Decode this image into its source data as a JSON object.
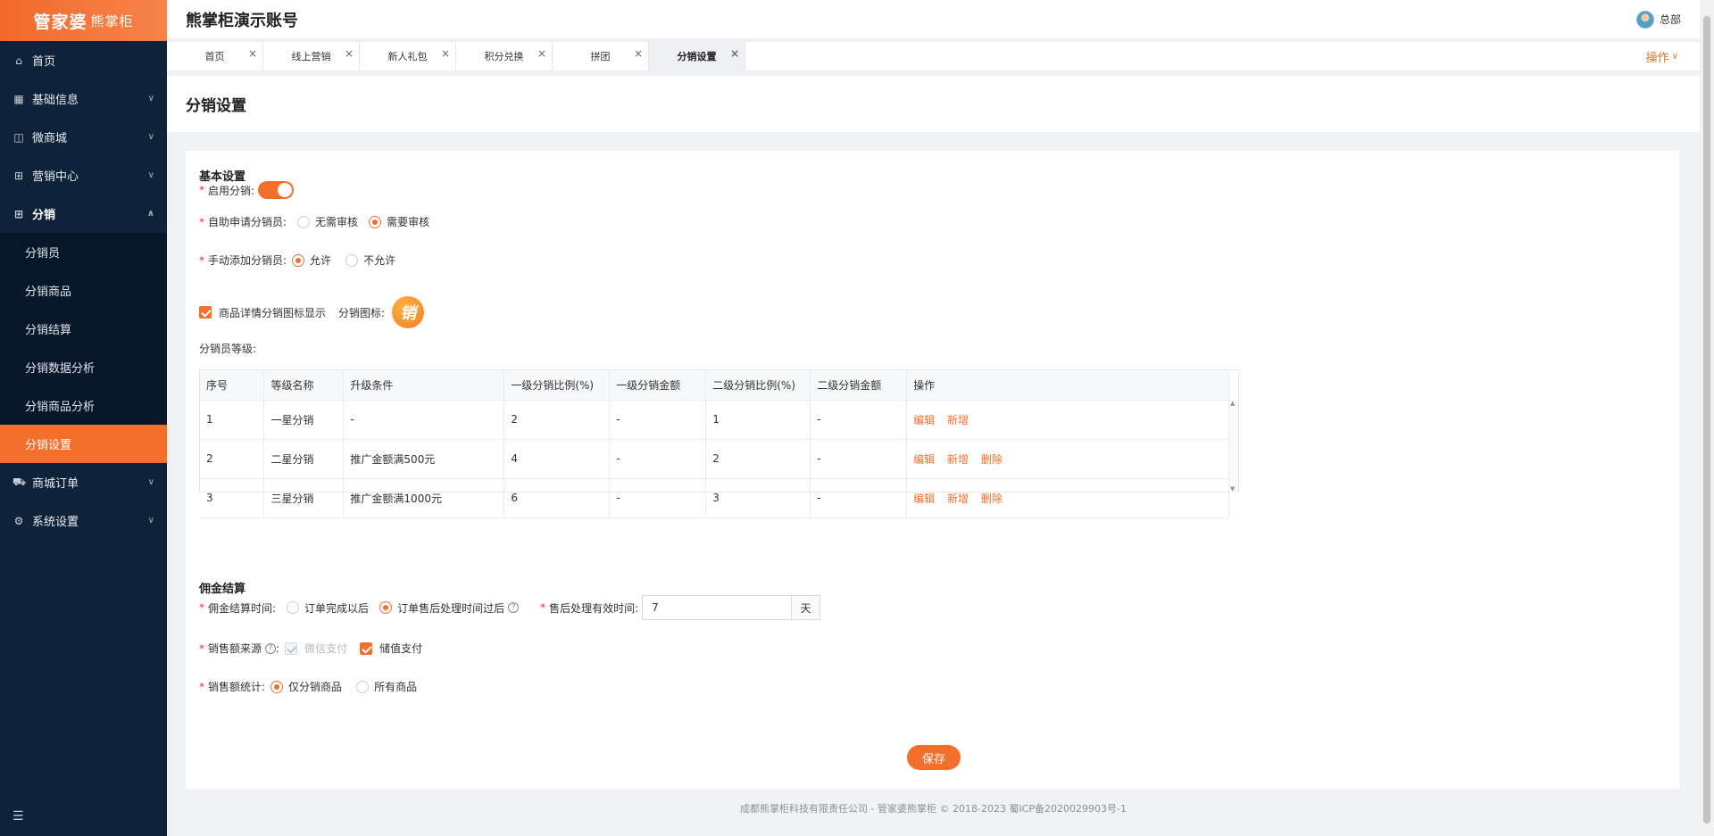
{
  "brand": {
    "logo_main": "管家婆",
    "logo_sub": "熊掌柜"
  },
  "header": {
    "account": "熊掌柜演示账号",
    "user": "总部"
  },
  "sidebar": {
    "items": [
      {
        "label": "首页",
        "icon": "home-icon"
      },
      {
        "label": "基础信息",
        "icon": "grid-icon"
      },
      {
        "label": "微商城",
        "icon": "bag-icon"
      },
      {
        "label": "营销中心",
        "icon": "gift-icon"
      },
      {
        "label": "分销",
        "icon": "gift-icon"
      },
      {
        "label": "商城订单",
        "icon": "cart-icon"
      },
      {
        "label": "系统设置",
        "icon": "gear-icon"
      }
    ],
    "sub_items": [
      "分销员",
      "分销商品",
      "分销结算",
      "分销数据分析",
      "分销商品分析",
      "分销设置"
    ]
  },
  "tabs": [
    "首页",
    "线上营销",
    "新人礼包",
    "积分兑换",
    "拼团",
    "分销设置"
  ],
  "tabs_ops": "操作",
  "page_title": "分销设置",
  "basic": {
    "title": "基本设置",
    "enable_label": "启用分销:",
    "self_apply_label": "自助申请分销员:",
    "self_apply_options": [
      "无需审核",
      "需要审核"
    ],
    "manual_add_label": "手动添加分销员:",
    "manual_add_options": [
      "允许",
      "不允许"
    ],
    "show_icon_label": "商品详情分销图标显示",
    "icon_label": "分销图标:",
    "icon_char": "销",
    "level_label": "分销员等级:"
  },
  "table": {
    "headers": [
      "序号",
      "等级名称",
      "升级条件",
      "一级分销比例(%)",
      "一级分销金额",
      "二级分销比例(%)",
      "二级分销金额",
      "操作"
    ],
    "rows": [
      [
        "1",
        "一星分销",
        "-",
        "2",
        "-",
        "1",
        "-"
      ],
      [
        "2",
        "二星分销",
        "推广金额满500元",
        "4",
        "-",
        "2",
        "-"
      ],
      [
        "3",
        "三星分销",
        "推广金额满1000元",
        "6",
        "-",
        "3",
        "-"
      ]
    ],
    "ops": {
      "edit": "编辑",
      "add": "新增",
      "delete": "删除"
    }
  },
  "commission": {
    "title": "佣金结算",
    "time_label": "佣金结算时间:",
    "time_options": [
      "订单完成以后",
      "订单售后处理时间过后"
    ],
    "after_sale_label": "售后处理有效时间:",
    "after_sale_value": "7",
    "after_sale_unit": "天",
    "source_label": "销售额来源",
    "source_options": [
      "微信支付",
      "储值支付"
    ],
    "stat_label": "销售额统计:",
    "stat_options": [
      "仅分销商品",
      "所有商品"
    ]
  },
  "save_label": "保存",
  "footer": "成都熊掌柜科技有限责任公司 - 管家婆熊掌柜 © 2018-2023 蜀ICP备2020029903号-1",
  "colors": {
    "accent": "#f36f2c",
    "sidebar_bg": "#0e2239"
  }
}
